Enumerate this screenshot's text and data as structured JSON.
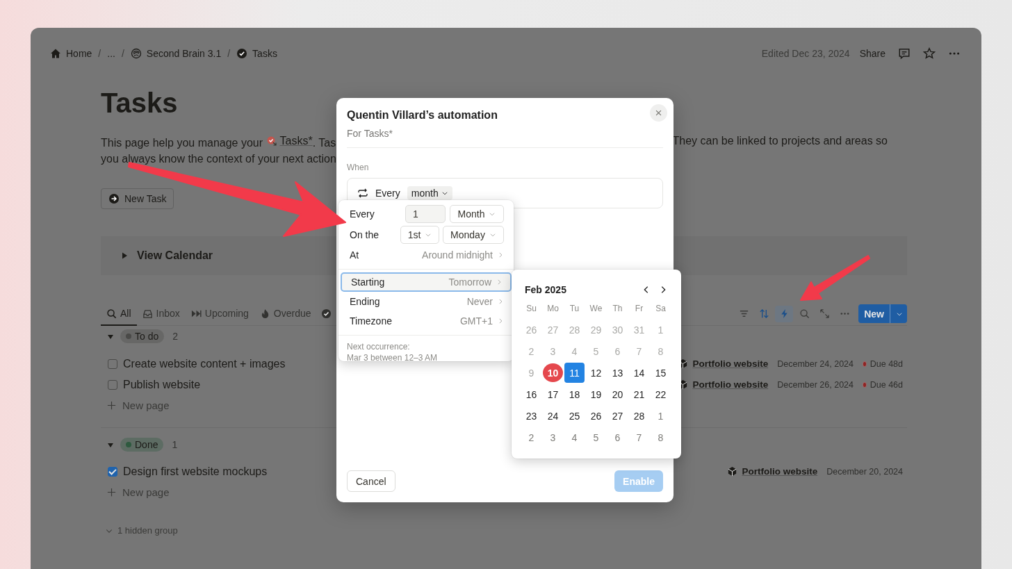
{
  "breadcrumbs": [
    "Home",
    "...",
    "Second Brain 3.1",
    "Tasks"
  ],
  "breadcrumb_separator": "/",
  "header": {
    "edited": "Edited Dec 23, 2024",
    "share": "Share"
  },
  "page": {
    "title": "Tasks",
    "description_start": "This page help you manage your",
    "description_link": "Tasks*",
    "description_cut": ". Tas",
    "description_right": "They can be linked to projects and areas so",
    "description_line2": "you always know the context of your next action",
    "new_task": "New Task",
    "view_calendar": "View Calendar"
  },
  "tabs": [
    {
      "label": "All",
      "selected": true
    },
    {
      "label": "Inbox",
      "selected": false
    },
    {
      "label": "Upcoming",
      "selected": false
    },
    {
      "label": "Overdue",
      "selected": false
    }
  ],
  "tools": [
    {
      "kind": "filter",
      "active": false,
      "open": false
    },
    {
      "kind": "sort",
      "active": true,
      "open": false
    },
    {
      "kind": "automation",
      "active": true,
      "open": true
    },
    {
      "kind": "search",
      "active": false,
      "open": false
    },
    {
      "kind": "expand",
      "active": false,
      "open": false
    },
    {
      "kind": "more",
      "active": false,
      "open": false
    }
  ],
  "new_button": "New",
  "groups": [
    {
      "name": "To do",
      "count": "2",
      "color": "#4a4a48",
      "new_page": "New page",
      "rows": [
        {
          "title": "Create website content + images",
          "checked": false,
          "project": "Portfolio website",
          "date": "December 24, 2024",
          "due": "Due 48d"
        },
        {
          "title": "Publish website",
          "checked": false,
          "project": "Portfolio website",
          "date": "December 26, 2024",
          "due": "Due 46d"
        }
      ]
    },
    {
      "name": "Done",
      "count": "1",
      "color": "#2e5a3f",
      "new_page": "New page",
      "rows": [
        {
          "title": "Design first website mockups",
          "checked": true,
          "project": "Portfolio website",
          "date": "December 20, 2024"
        }
      ]
    }
  ],
  "hidden_groups": "1 hidden group",
  "modal": {
    "title": "Quentin Villard’s automation",
    "subtitle": "For Tasks*",
    "when_label": "When",
    "trigger_prefix": "Every",
    "trigger_value": "month",
    "cancel": "Cancel",
    "enable": "Enable",
    "enable_disabled": true
  },
  "popover": {
    "every_label": "Every",
    "every_value": "1",
    "every_unit": "Month",
    "on_label": "On the",
    "on_ordinal": "1st",
    "on_day": "Monday",
    "time_rows": [
      {
        "label": "At",
        "value": "Around midnight",
        "selected": false
      }
    ],
    "range_rows": [
      {
        "label": "Starting",
        "value": "Tomorrow",
        "selected": true
      },
      {
        "label": "Ending",
        "value": "Never",
        "selected": false
      },
      {
        "label": "Timezone",
        "value": "GMT+1",
        "selected": false
      }
    ],
    "next_label": "Next occurrence:",
    "next_value": "Mar 3 between 12–3 AM"
  },
  "calendar": {
    "month": "Feb 2025",
    "weekdays": [
      "Su",
      "Mo",
      "Tu",
      "We",
      "Th",
      "Fr",
      "Sa"
    ],
    "days": [
      {
        "label": "26",
        "kind": "outside",
        "selected": false
      },
      {
        "label": "27",
        "kind": "outside",
        "selected": false
      },
      {
        "label": "28",
        "kind": "outside",
        "selected": false
      },
      {
        "label": "29",
        "kind": "outside",
        "selected": false
      },
      {
        "label": "30",
        "kind": "outside",
        "selected": false
      },
      {
        "label": "31",
        "kind": "outside",
        "selected": false
      },
      {
        "label": "1",
        "kind": "outside",
        "selected": false
      },
      {
        "label": "2",
        "kind": "outside",
        "selected": false
      },
      {
        "label": "3",
        "kind": "outside",
        "selected": false
      },
      {
        "label": "4",
        "kind": "outside",
        "selected": false
      },
      {
        "label": "5",
        "kind": "outside",
        "selected": false
      },
      {
        "label": "6",
        "kind": "outside",
        "selected": false
      },
      {
        "label": "7",
        "kind": "outside",
        "selected": false
      },
      {
        "label": "8",
        "kind": "outside",
        "selected": false
      },
      {
        "label": "9",
        "kind": "outside",
        "selected": false
      },
      {
        "label": "10",
        "kind": "today",
        "selected": false
      },
      {
        "label": "11",
        "kind": "current",
        "selected": true
      },
      {
        "label": "12",
        "kind": "current",
        "selected": false
      },
      {
        "label": "13",
        "kind": "current",
        "selected": false
      },
      {
        "label": "14",
        "kind": "current",
        "selected": false
      },
      {
        "label": "15",
        "kind": "current",
        "selected": false
      },
      {
        "label": "16",
        "kind": "current",
        "selected": false
      },
      {
        "label": "17",
        "kind": "current",
        "selected": false
      },
      {
        "label": "18",
        "kind": "current",
        "selected": false
      },
      {
        "label": "19",
        "kind": "current",
        "selected": false
      },
      {
        "label": "20",
        "kind": "current",
        "selected": false
      },
      {
        "label": "21",
        "kind": "current",
        "selected": false
      },
      {
        "label": "22",
        "kind": "current",
        "selected": false
      },
      {
        "label": "23",
        "kind": "current",
        "selected": false
      },
      {
        "label": "24",
        "kind": "current",
        "selected": false
      },
      {
        "label": "25",
        "kind": "current",
        "selected": false
      },
      {
        "label": "26",
        "kind": "current",
        "selected": false
      },
      {
        "label": "27",
        "kind": "current",
        "selected": false
      },
      {
        "label": "28",
        "kind": "current",
        "selected": false
      },
      {
        "label": "1",
        "kind": "next",
        "selected": false
      },
      {
        "label": "2",
        "kind": "next",
        "selected": false
      },
      {
        "label": "3",
        "kind": "next",
        "selected": false
      },
      {
        "label": "4",
        "kind": "next",
        "selected": false
      },
      {
        "label": "5",
        "kind": "next",
        "selected": false
      },
      {
        "label": "6",
        "kind": "next",
        "selected": false
      },
      {
        "label": "7",
        "kind": "next",
        "selected": false
      },
      {
        "label": "8",
        "kind": "next",
        "selected": false
      }
    ]
  }
}
